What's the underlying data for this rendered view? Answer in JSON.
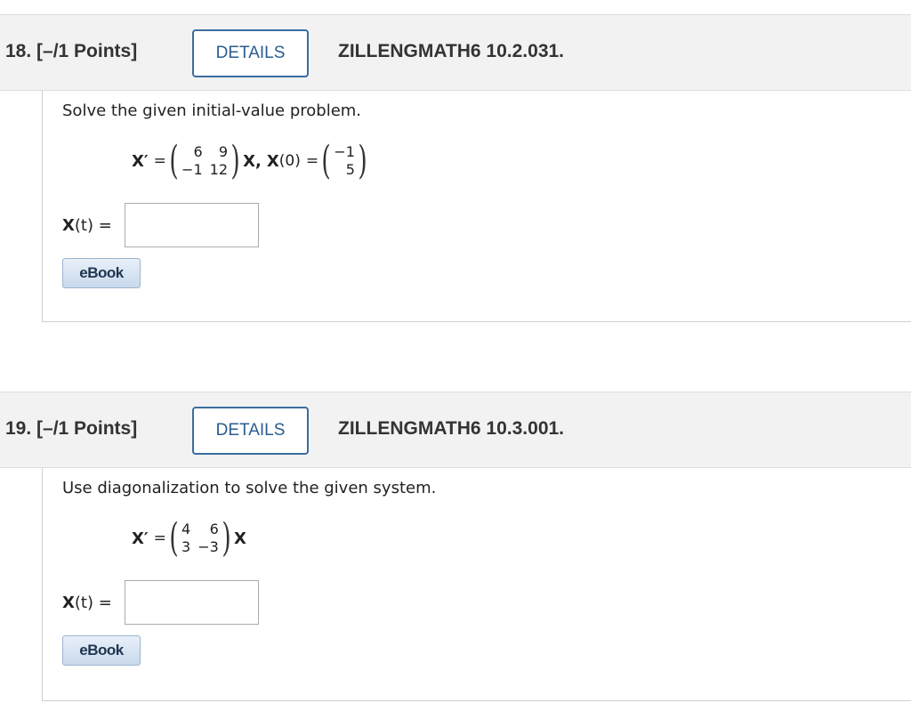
{
  "questions": [
    {
      "number_label": "18. [–/1 Points]",
      "details_label": "DETAILS",
      "code": "ZILLENGMATH6 10.2.031.",
      "prompt": "Solve the given initial-value problem.",
      "lhs": "X′",
      "equals": "=",
      "matrix": [
        [
          "6",
          "9"
        ],
        [
          "−1",
          "12"
        ]
      ],
      "rhs_suffix": "X,",
      "ic_label": "X",
      "ic_arg": "(0)",
      "ic_vector": [
        "−1",
        "5"
      ],
      "answer_label_x": "X",
      "answer_label_arg": "(t)",
      "answer_equals": "=",
      "answer_value": "",
      "ebook_label": "eBook"
    },
    {
      "number_label": "19. [–/1 Points]",
      "details_label": "DETAILS",
      "code": "ZILLENGMATH6 10.3.001.",
      "prompt": "Use diagonalization to solve the given system.",
      "lhs": "X′",
      "equals": "=",
      "matrix": [
        [
          "4",
          "6"
        ],
        [
          "3",
          "−3"
        ]
      ],
      "rhs_suffix": "X",
      "answer_label_x": "X",
      "answer_label_arg": "(t)",
      "answer_equals": "=",
      "answer_value": "",
      "ebook_label": "eBook"
    }
  ]
}
